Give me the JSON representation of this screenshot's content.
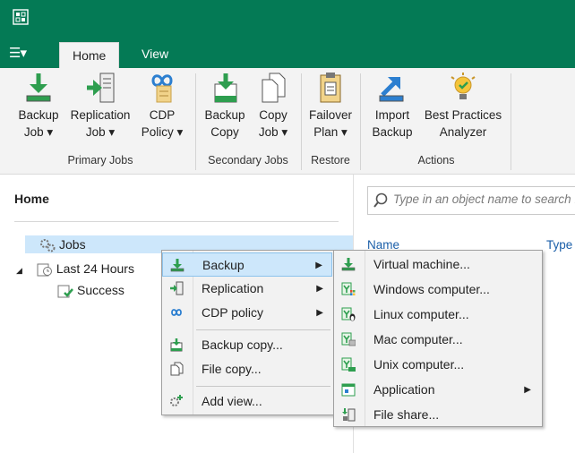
{
  "app": {
    "logo_icon": "veeam-logo-icon",
    "accent": "#047a55"
  },
  "tabs": [
    {
      "label": "Home",
      "active": true
    },
    {
      "label": "View",
      "active": false
    }
  ],
  "ribbon": {
    "buttons": [
      {
        "l1": "Backup",
        "l2": "Job ▾",
        "icon": "backup-job-icon"
      },
      {
        "l1": "Replication",
        "l2": "Job ▾",
        "icon": "replication-job-icon"
      },
      {
        "l1": "CDP",
        "l2": "Policy ▾",
        "icon": "cdp-policy-icon"
      },
      {
        "l1": "Backup",
        "l2": "Copy",
        "icon": "backup-copy-icon"
      },
      {
        "l1": "Copy",
        "l2": "Job ▾",
        "icon": "copy-job-icon"
      },
      {
        "l1": "Failover",
        "l2": "Plan ▾",
        "icon": "failover-plan-icon"
      },
      {
        "l1": "Import",
        "l2": "Backup",
        "icon": "import-backup-icon"
      },
      {
        "l1": "Best Practices",
        "l2": "Analyzer",
        "icon": "best-practices-analyzer-icon"
      }
    ],
    "groups": [
      "Primary Jobs",
      "Secondary Jobs",
      "Restore",
      "Actions"
    ]
  },
  "left_pane": {
    "title": "Home",
    "tree": [
      {
        "label": "Jobs",
        "icon": "jobs-icon"
      },
      {
        "label": "Last 24 Hours",
        "icon": "last-24-hours-icon",
        "expander": "◢"
      },
      {
        "label": "Success",
        "icon": "success-icon"
      }
    ]
  },
  "right_pane": {
    "search_placeholder": "Type in an object name to search for",
    "columns": [
      "Name",
      "Type"
    ]
  },
  "context_menu": {
    "items": [
      {
        "label": "Backup",
        "submenu": true,
        "highlighted": true,
        "icon": "backup-icon"
      },
      {
        "label": "Replication",
        "submenu": true,
        "icon": "replication-icon"
      },
      {
        "label": "CDP policy",
        "submenu": true,
        "icon": "cdp-icon"
      },
      {
        "label": "Backup copy...",
        "icon": "backup-copy-icon"
      },
      {
        "label": "File copy...",
        "icon": "file-copy-icon"
      },
      {
        "label": "Add view...",
        "icon": "add-view-icon"
      }
    ]
  },
  "submenu": {
    "items": [
      {
        "label": "Virtual machine...",
        "icon": "virtual-machine-icon"
      },
      {
        "label": "Windows computer...",
        "icon": "windows-computer-icon"
      },
      {
        "label": "Linux computer...",
        "icon": "linux-computer-icon"
      },
      {
        "label": "Mac computer...",
        "icon": "mac-computer-icon"
      },
      {
        "label": "Unix computer...",
        "icon": "unix-computer-icon"
      },
      {
        "label": "Application",
        "submenu": true,
        "icon": "application-icon"
      },
      {
        "label": "File share...",
        "icon": "file-share-icon"
      }
    ]
  }
}
